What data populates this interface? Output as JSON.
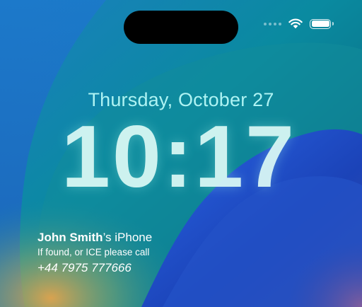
{
  "lockscreen": {
    "date": "Thursday, October 27",
    "time": "10:17",
    "owner": {
      "name": "John Smith",
      "device_suffix": "’s iPhone",
      "note": "If found, or ICE please call",
      "phone": "+44 7975 777666"
    }
  },
  "status_bar": {
    "cell_icon": "cellular-signal-icon",
    "wifi_icon": "wifi-icon",
    "battery_icon": "battery-icon",
    "battery_level": 1.0
  },
  "colors": {
    "date": "#aef3f3",
    "time": "#dcfaf6",
    "wallpaper_teal": "#0a7c8e",
    "wallpaper_blue": "#1a4fd0",
    "wallpaper_orange": "#d69a4e"
  }
}
